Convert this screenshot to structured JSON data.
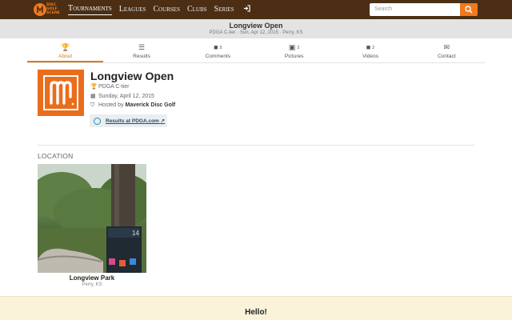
{
  "nav": {
    "logo_lines": [
      "DISC",
      "GOLF",
      "SCENE"
    ],
    "links": [
      "Tournaments",
      "Leagues",
      "Courses",
      "Clubs",
      "Series"
    ],
    "search_placeholder": "Search"
  },
  "event": {
    "title": "Longview Open",
    "subtitle": "PDGA C-tier · Sun, Apr 12, 2015 · Perry, KS",
    "tier": "PDGA C-tier",
    "date": "Sunday, April 12, 2015",
    "hosted_prefix": "Hosted by",
    "host": "Maverick Disc Golf",
    "results_link": "Results at PDGA.com"
  },
  "tabs": [
    {
      "label": "About",
      "icon": "trophy-icon",
      "count": ""
    },
    {
      "label": "Results",
      "icon": "list-icon",
      "count": ""
    },
    {
      "label": "Comments",
      "icon": "comment-icon",
      "count": "5"
    },
    {
      "label": "Pictures",
      "icon": "picture-icon",
      "count": "2"
    },
    {
      "label": "Videos",
      "icon": "video-icon",
      "count": "2"
    },
    {
      "label": "Contact",
      "icon": "envelope-icon",
      "count": ""
    }
  ],
  "location": {
    "heading": "LOCATION",
    "name": "Longview Park",
    "place": "Perry, KS",
    "sign_number": "14"
  },
  "footer": {
    "hello": "Hello!"
  },
  "colors": {
    "topbar": "#4b2e14",
    "accent": "#f07a1d",
    "active_tab": "#d97a24",
    "band": "#e3e3e3",
    "hello_bg": "#fbf3d9"
  }
}
